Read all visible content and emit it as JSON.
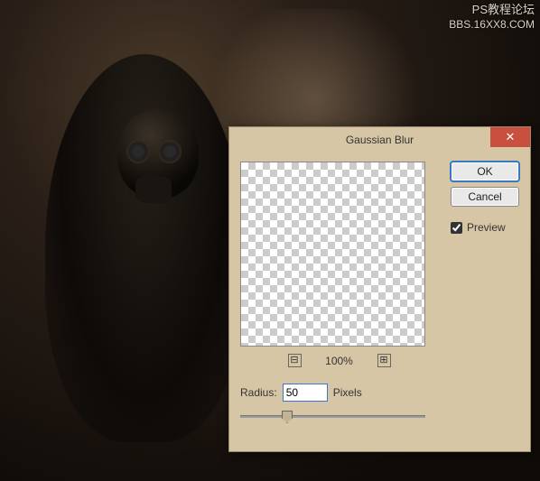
{
  "watermark": {
    "line1": "PS教程论坛",
    "line2": "BBS.16XX8.COM"
  },
  "dialog": {
    "title": "Gaussian Blur",
    "close_symbol": "✕",
    "ok_label": "OK",
    "cancel_label": "Cancel",
    "preview_label": "Preview",
    "preview_checked": true,
    "zoom": {
      "minus": "⊟",
      "plus": "⊞",
      "percent": "100%"
    },
    "radius": {
      "label": "Radius:",
      "value": "50",
      "unit": "Pixels"
    }
  }
}
